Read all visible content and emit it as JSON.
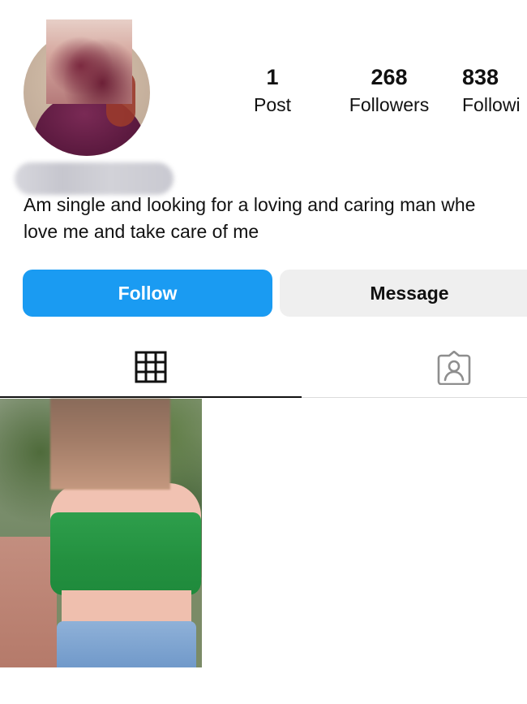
{
  "profile": {
    "stats": {
      "posts": {
        "value": "1",
        "label": "Post"
      },
      "followers": {
        "value": "268",
        "label": "Followers"
      },
      "following": {
        "value": "838",
        "label": "Followi"
      }
    },
    "bio": "Am single and looking for a loving and caring man whe\nlove me and take care of me"
  },
  "actions": {
    "follow_label": "Follow",
    "message_label": "Message"
  },
  "tabs": {
    "posts_icon": "grid-icon",
    "tagged_icon": "tagged-person-icon"
  },
  "colors": {
    "follow_button": "#1a9bf2",
    "message_button": "#efefef",
    "active_tab_underline": "#111111"
  },
  "posts": [
    {
      "kind": "photo"
    }
  ]
}
